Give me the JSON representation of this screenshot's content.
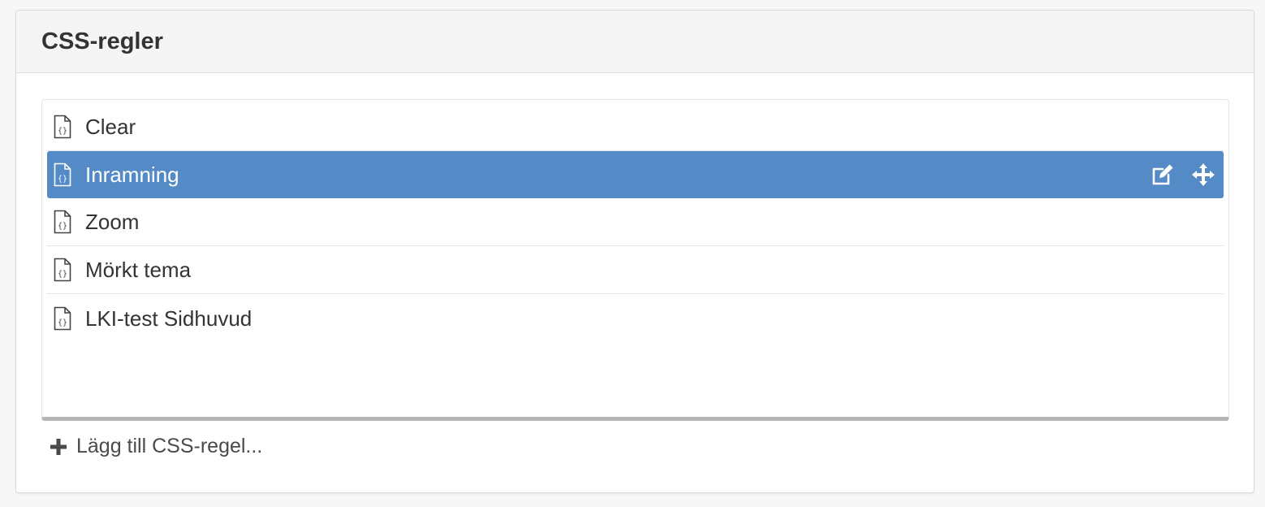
{
  "panel": {
    "title": "CSS-regler"
  },
  "rules": [
    {
      "label": "Clear",
      "selected": false
    },
    {
      "label": "Inramning",
      "selected": true
    },
    {
      "label": "Zoom",
      "selected": false
    },
    {
      "label": "Mörkt tema",
      "selected": false
    },
    {
      "label": "LKI-test Sidhuvud",
      "selected": false
    }
  ],
  "row_actions": {
    "edit_icon": "edit-icon",
    "move_icon": "move-icon"
  },
  "add_rule": {
    "label": "Lägg till CSS-regel...",
    "icon": "plus-icon"
  },
  "colors": {
    "selected_bg": "#548ac5",
    "selected_text": "#ffffff",
    "text": "#333333"
  }
}
